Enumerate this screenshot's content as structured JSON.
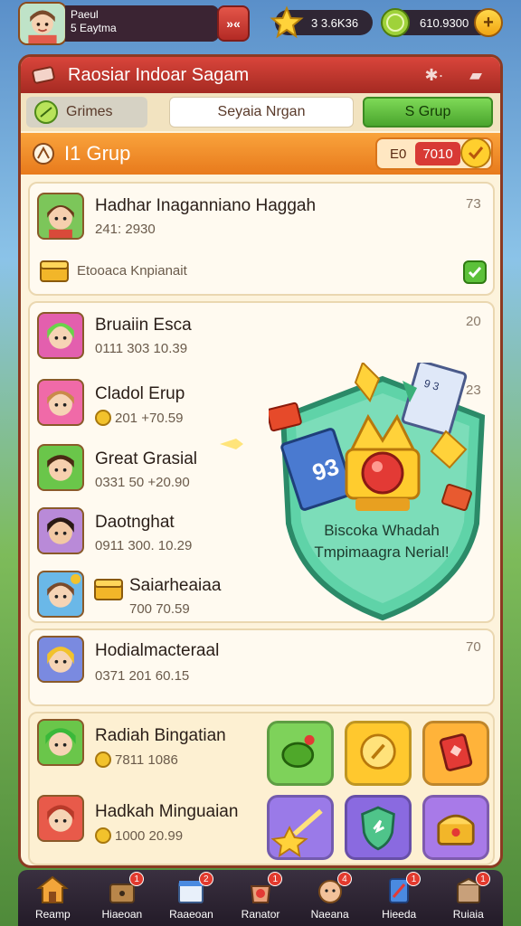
{
  "player": {
    "name": "Paeul",
    "subtitle": "5 Eaytma"
  },
  "top_close_label": "»«",
  "currency": {
    "stars": "3 3.6K36",
    "coins": "610.9300",
    "plus": "+"
  },
  "panel": {
    "title": "Raosiar Indoar Sagam"
  },
  "tabs": {
    "games": "Grimes",
    "search": "Seyaia Nrgan",
    "group": "S Grup"
  },
  "group_header": {
    "title": "I1 Grup",
    "counter_left": "E0",
    "counter_value": "7010"
  },
  "top_entry": {
    "name": "Hadhar Inaganniano Haggah",
    "meta": "241: 2930",
    "rank": "73",
    "reward_label": "Etooaca Knpianait"
  },
  "entries": [
    {
      "name": "Bruaiin Esca",
      "meta": "0111 303   10.39",
      "rank": "20"
    },
    {
      "name": "Cladol Erup",
      "meta": "201   +70.59",
      "rank": "23"
    },
    {
      "name": "Great Grasial",
      "meta": "0331 50   +20.90",
      "rank": ""
    },
    {
      "name": "Daotnghat",
      "meta": "0911 300.   10.29",
      "rank": ""
    },
    {
      "name": "Saiarheaiaa",
      "meta": "700   70.59",
      "rank": ""
    }
  ],
  "low_entry": {
    "name": "Hodialmacteraal",
    "meta": "0371 201   60.15",
    "rank": "70"
  },
  "shield_text": {
    "line1": "Biscoka Whadah",
    "line2": "Tmpimaagra Nerial!"
  },
  "shield_card_number": "93",
  "shield_card_small": "9 3",
  "bottom_entries": [
    {
      "name": "Radiah Bingatian",
      "meta": "7811   1086"
    },
    {
      "name": "Hadkah Minguaian",
      "meta": "1000   20.99"
    }
  ],
  "nav": [
    {
      "label": "Reamp",
      "icon": "home-icon",
      "badge": ""
    },
    {
      "label": "Hiaeoan",
      "icon": "chest-icon",
      "badge": "1"
    },
    {
      "label": "Raaeoan",
      "icon": "store-icon",
      "badge": "2"
    },
    {
      "label": "Ranator",
      "icon": "bag-icon",
      "badge": "1"
    },
    {
      "label": "Naeana",
      "icon": "face-icon",
      "badge": "4"
    },
    {
      "label": "Hieeda",
      "icon": "card-icon",
      "badge": "1"
    },
    {
      "label": "Ruiaia",
      "icon": "box-icon",
      "badge": "1"
    }
  ],
  "colors": {
    "title_bar": "#c53a30",
    "header_orange": "#f39530",
    "panel_bg": "#fdf3dc",
    "group_tab": "#5cbf3a",
    "nav_bg": "#2e2533"
  }
}
